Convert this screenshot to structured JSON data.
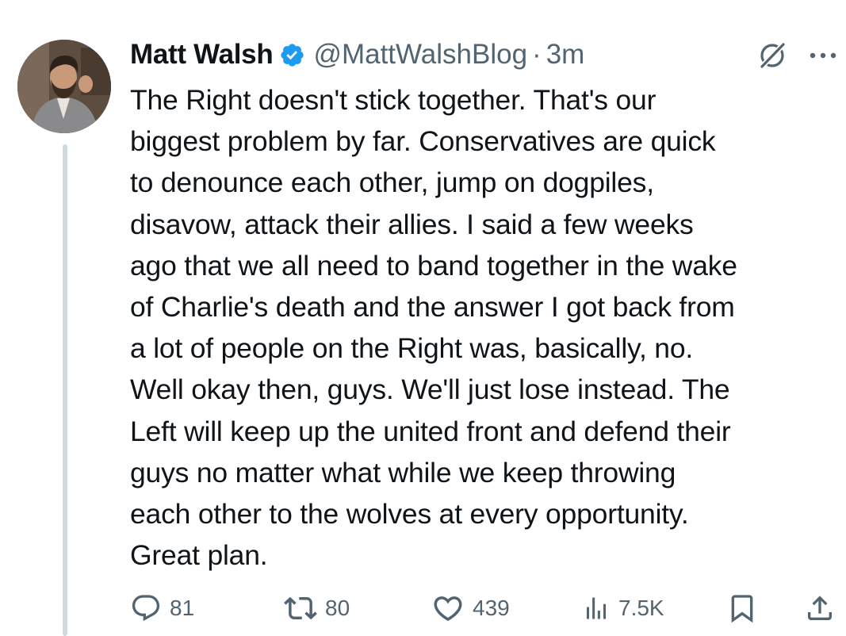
{
  "tweet": {
    "author_name": "Matt Walsh",
    "handle": "@MattWalshBlog",
    "separator": "·",
    "time": "3m",
    "verified_color": "#1d9bf0",
    "body_lines": [
      "The Right doesn't stick together. That's our",
      "biggest problem by far. Conservatives are quick",
      "to denounce each other, jump on dogpiles,",
      "disavow, attack their allies. I said a few weeks",
      "ago that we all need to band together in the wake",
      "of Charlie's death and the answer I got back from",
      "a lot of people on the Right was, basically, no.",
      "Well okay then, guys. We'll just lose instead. The",
      "Left will keep up the united front and defend their",
      "guys no matter what while we keep throwing",
      "each other to the wolves at every opportunity.",
      "Great plan."
    ]
  },
  "actions": {
    "replies": "81",
    "reposts": "80",
    "likes": "439",
    "views": "7.5K"
  },
  "icons": {
    "verified": "verified-badge-icon",
    "grok": "grok-icon",
    "more": "more-options-icon",
    "reply": "reply-icon",
    "repost": "repost-icon",
    "like": "heart-icon",
    "views": "views-chart-icon",
    "bookmark": "bookmark-icon",
    "share": "share-icon"
  },
  "colors": {
    "text": "#0f1419",
    "secondary": "#536471",
    "thread_line": "#cfd9de"
  }
}
